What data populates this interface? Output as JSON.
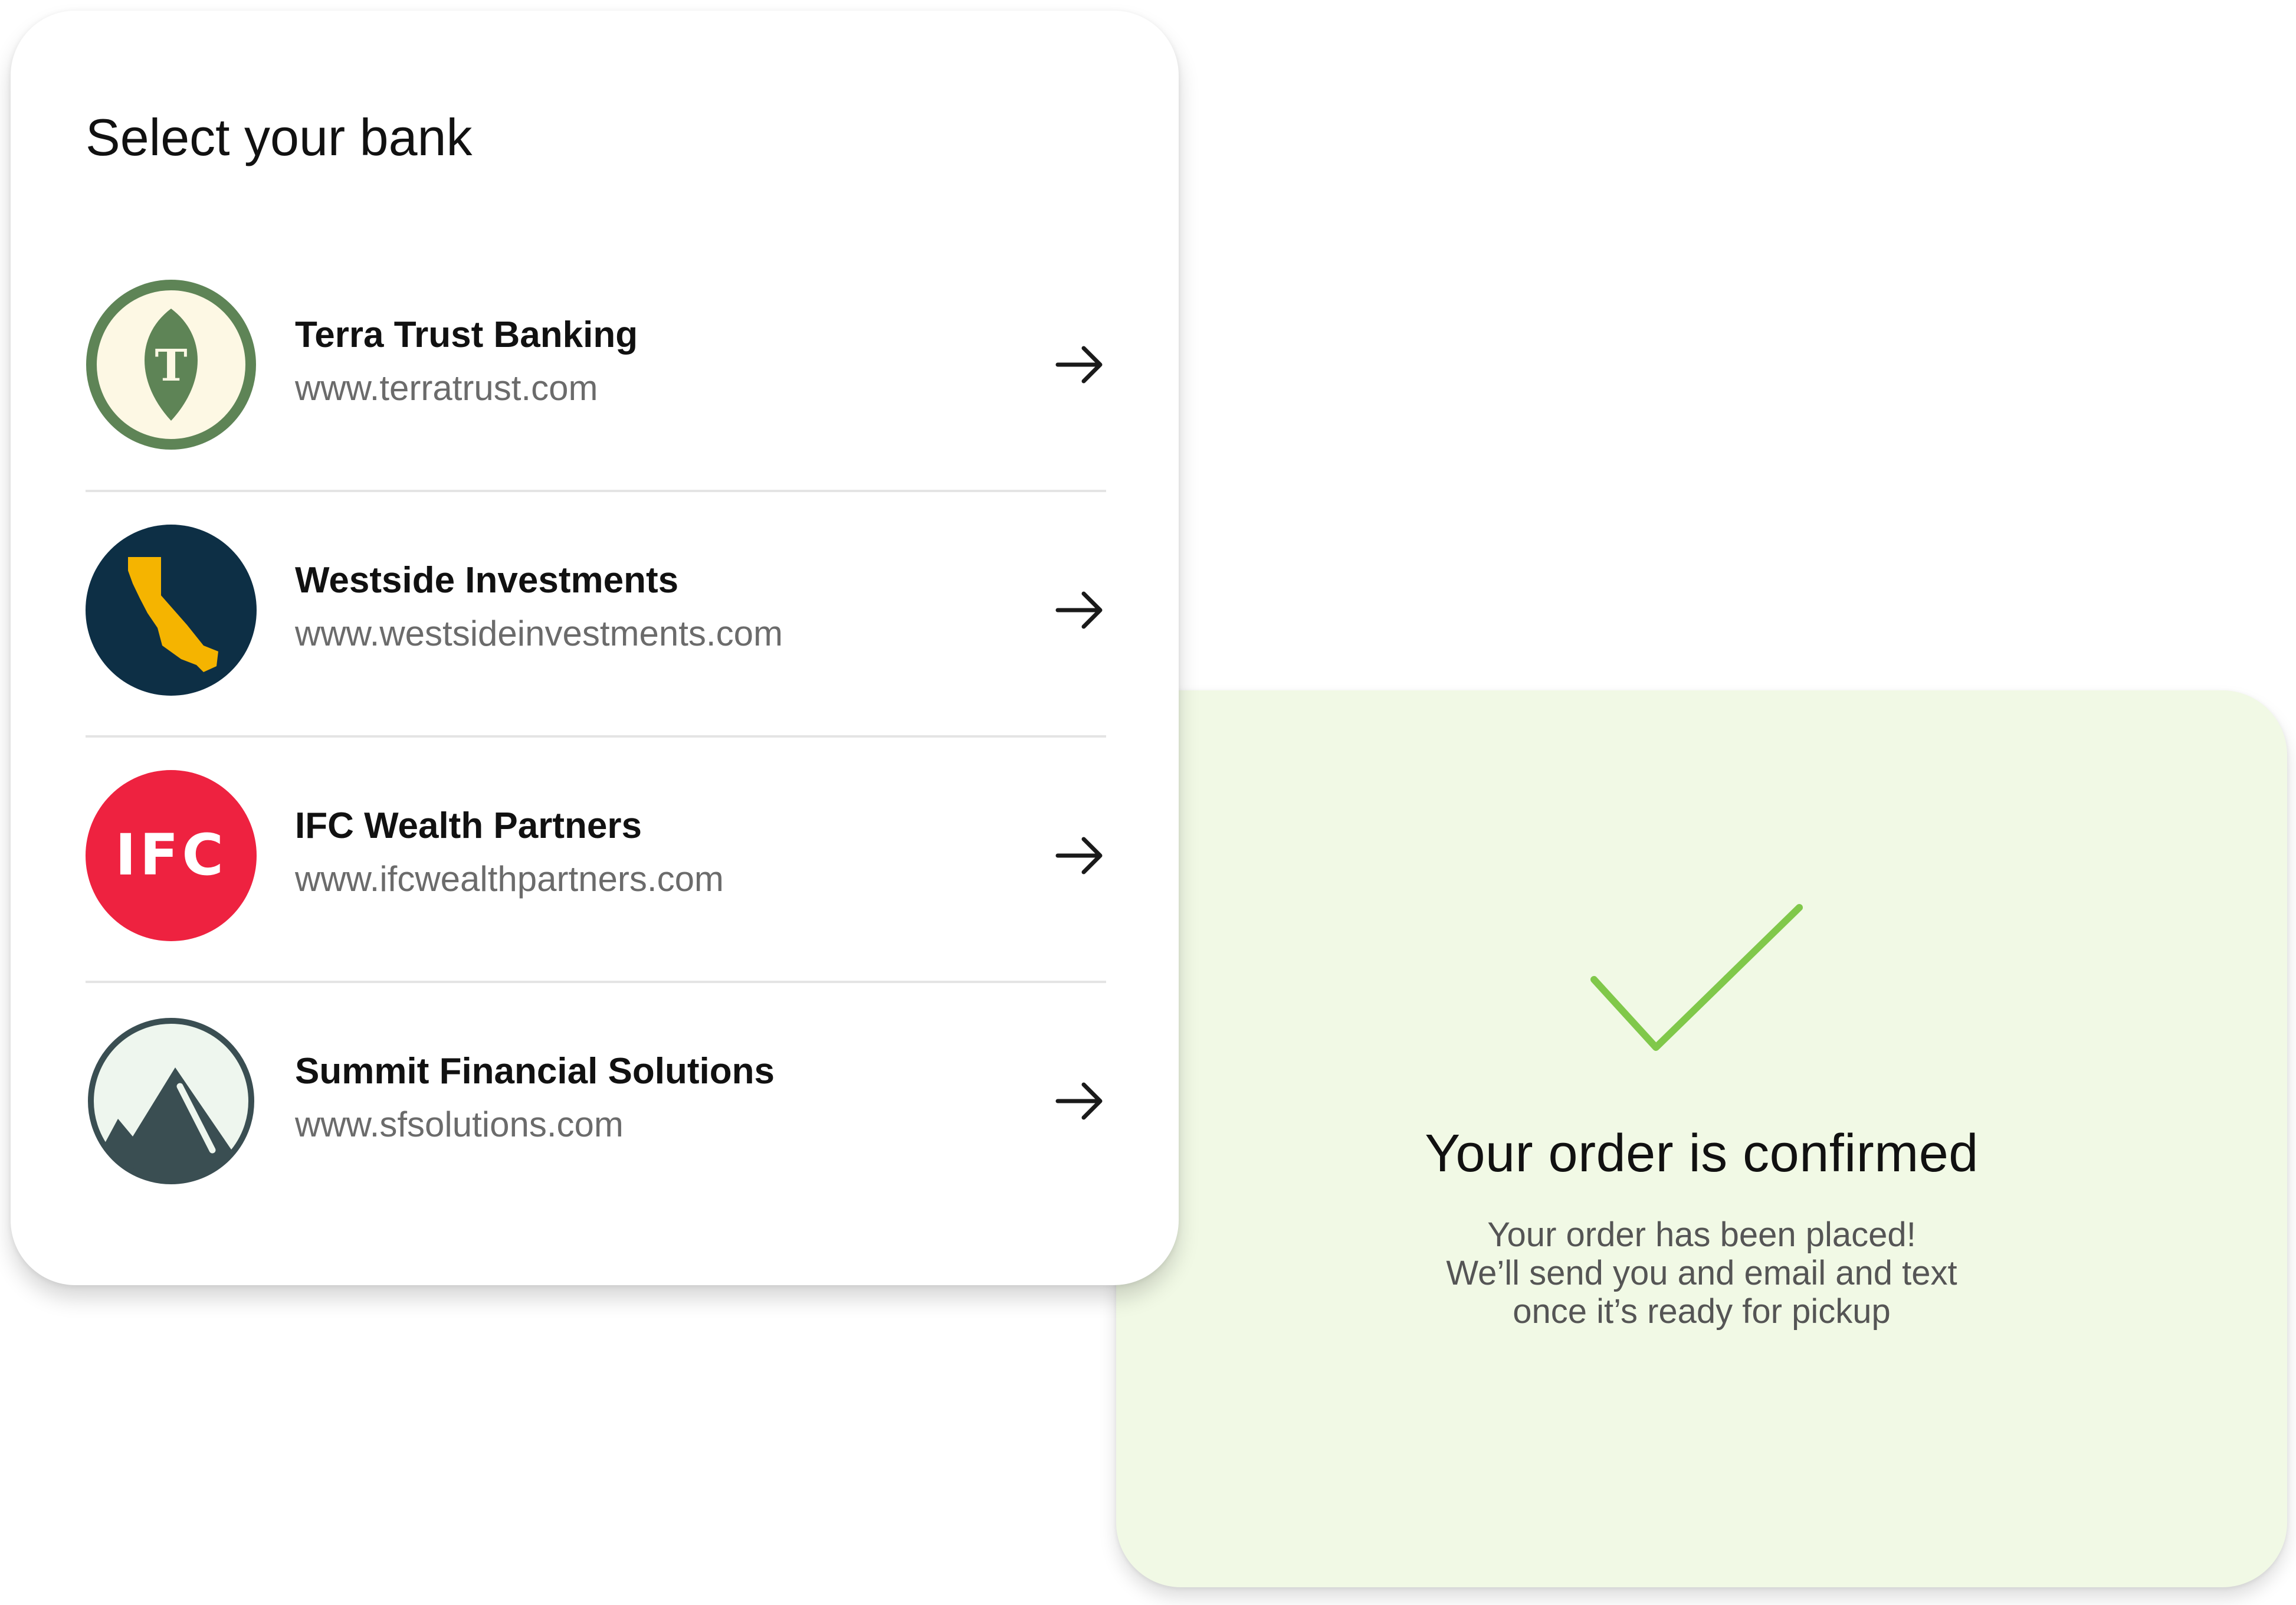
{
  "bank_selector": {
    "title": "Select your bank",
    "banks": [
      {
        "name": "Terra Trust Banking",
        "url": "www.terratrust.com",
        "logo_icon": "terra-trust-leaf-logo",
        "logo_letter": "T"
      },
      {
        "name": "Westside Investments",
        "url": "www.westsideinvestments.com",
        "logo_icon": "california-state-logo"
      },
      {
        "name": "IFC Wealth Partners",
        "url": "www.ifcwealthpartners.com",
        "logo_icon": "ifc-logo",
        "logo_text": "IFC"
      },
      {
        "name": "Summit Financial Solutions",
        "url": "www.sfsolutions.com",
        "logo_icon": "mountain-logo"
      }
    ],
    "arrow_icon": "arrow-right-icon"
  },
  "confirmation": {
    "icon": "checkmark-icon",
    "title": "Your order is confirmed",
    "message_lines": [
      "Your order has been placed!",
      "We’ll send you and email and text",
      "once it’s ready for pickup"
    ]
  },
  "colors": {
    "terra_green": "#5e8456",
    "terra_cream": "#fdf8e4",
    "westside_navy": "#0d2f45",
    "westside_gold": "#f5b400",
    "ifc_red": "#ee2240",
    "summit_slate": "#3a4e52",
    "summit_mint": "#eef6ee",
    "confirm_bg": "#f1f9e5",
    "check_green": "#80c84a"
  }
}
